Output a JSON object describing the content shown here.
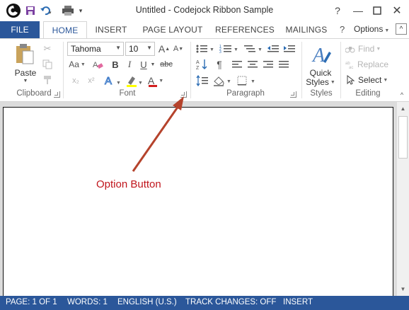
{
  "window": {
    "title": "Untitled - Codejock Ribbon Sample"
  },
  "tabs": {
    "file": "FILE",
    "home": "HOME",
    "insert": "INSERT",
    "page_layout": "PAGE LAYOUT",
    "references": "REFERENCES",
    "mailings": "MAILINGS",
    "options": "Options"
  },
  "clipboard": {
    "paste_label": "Paste",
    "group_label": "Clipboard"
  },
  "font": {
    "family": "Tahoma",
    "size": "10",
    "group_label": "Font",
    "change_case": "Aa",
    "bold": "B",
    "italic": "I",
    "underline": "U",
    "strikethrough": "abc",
    "subscript": "x₂",
    "superscript": "x²",
    "font_color": "A",
    "grow": "A",
    "shrink": "A"
  },
  "paragraph": {
    "group_label": "Paragraph",
    "show_marks": "¶"
  },
  "styles": {
    "quick_styles_line1": "Quick",
    "quick_styles_line2": "Styles",
    "group_label": "Styles"
  },
  "editing": {
    "find": "Find",
    "replace": "Replace",
    "select": "Select",
    "group_label": "Editing"
  },
  "annotation": {
    "text": "Option Button"
  },
  "status": {
    "page": "PAGE: 1 OF 1",
    "words": "WORDS: 1",
    "language": "ENGLISH (U.S.)",
    "track_changes": "TRACK CHANGES: OFF",
    "mode": "INSERT"
  },
  "colors": {
    "accent": "#2b579a",
    "annotation": "#c0151c",
    "font_color_bar": "#d21f1f"
  }
}
